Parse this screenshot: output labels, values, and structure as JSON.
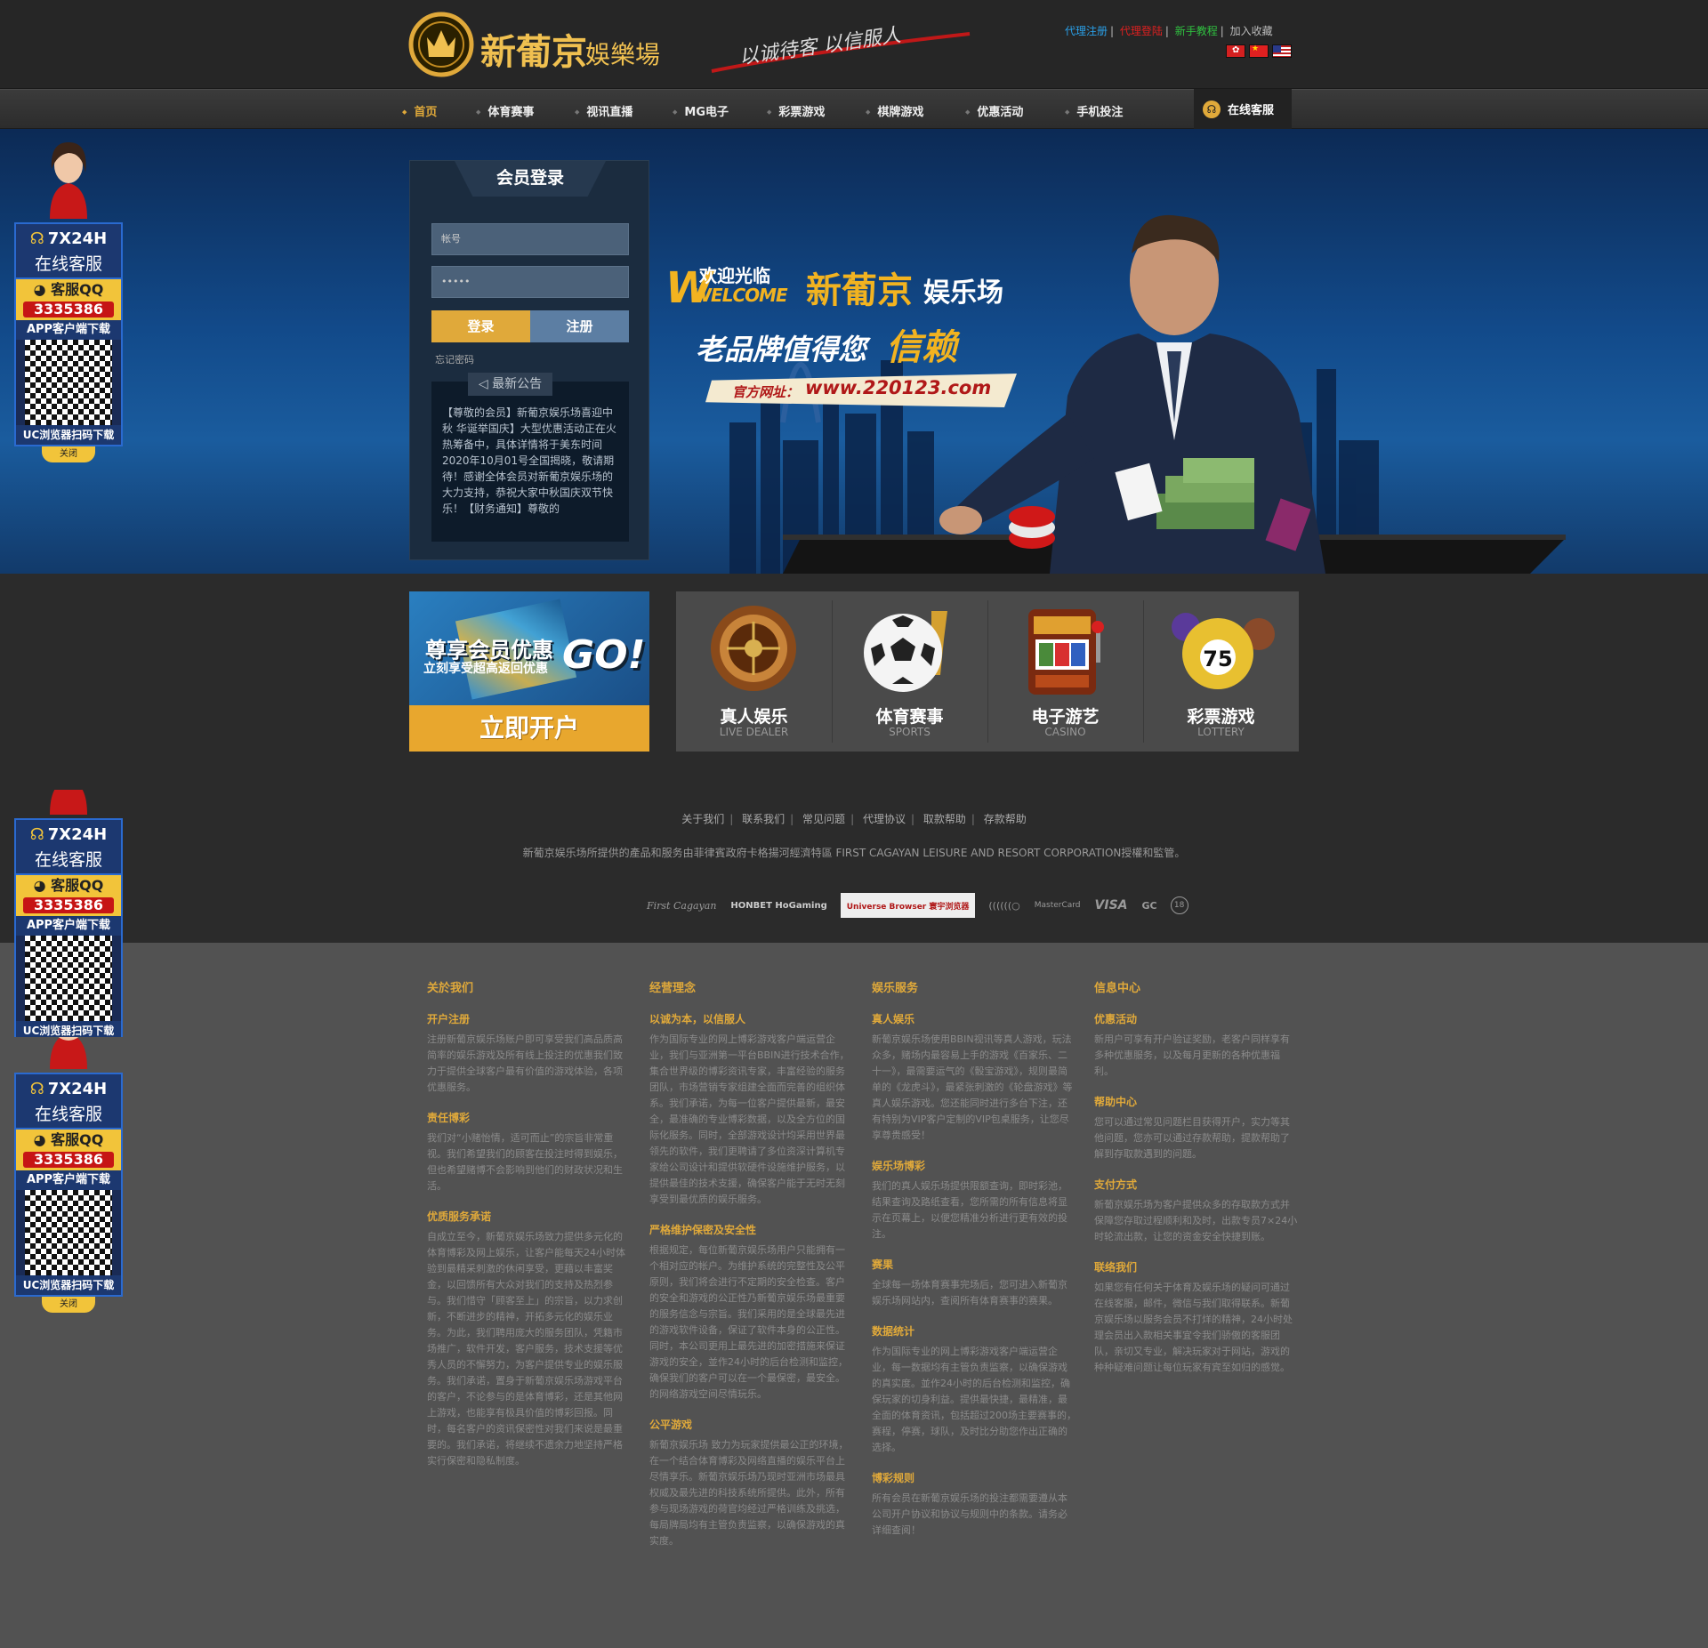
{
  "header": {
    "logo_text": "新葡京",
    "logo_sub": "娛樂場",
    "slogan": "以诚待客 以信服人",
    "links": [
      "代理注册",
      "代理登陆",
      "新手教程",
      "加入收藏"
    ],
    "link_colors": [
      "#2aa0e8",
      "#e02020",
      "#30c040",
      "#bbbbbb"
    ],
    "flags": [
      "hong-kong-flag",
      "china-flag",
      "usa-flag"
    ]
  },
  "nav": {
    "items": [
      "首页",
      "体育赛事",
      "视讯直播",
      "MG电子",
      "彩票游戏",
      "棋牌游戏",
      "优惠活动",
      "手机投注"
    ],
    "customer_service": "在线客服"
  },
  "login": {
    "title": "会员登录",
    "account_placeholder": "帐号",
    "password_value": "•••••",
    "login_button": "登录",
    "register_button": "注册",
    "forgot": "忘记密码",
    "notice_title": "最新公告",
    "notice_text": "【尊敬的会员】新葡京娱乐场喜迎中秋 华诞举国庆】大型优惠活动正在火热筹备中，具体详情将于美东时间2020年10月01号全国揭晓，敬请期待！感谢全体会员对新葡京娱乐场的大力支持，恭祝大家中秋国庆双节快乐！【财务通知】尊敬的"
  },
  "banner": {
    "welcome_cn": "欢迎光临",
    "welcome_en": "WELCOME",
    "brand": "新葡京",
    "brand_suffix": "娱乐场",
    "tagline_a": "老品牌值得您",
    "tagline_b": "信赖",
    "site_label": "官方网址：",
    "site_url": "www.220123.com"
  },
  "float_ad": {
    "hours": "7X24H",
    "service": "在线客服",
    "qq_label": "客服QQ",
    "qq_number": "3335386",
    "app": "APP客户端下载",
    "uc": "UC浏览器扫码下载",
    "close": "关闭"
  },
  "promo": {
    "title": "尊享会员优惠",
    "subtitle": "立刻享受超高返回优惠",
    "go": "GO!",
    "button": "立即开户"
  },
  "games": [
    {
      "title": "真人娱乐",
      "sub": "LIVE DEALER",
      "icon": "roulette-icon"
    },
    {
      "title": "体育赛事",
      "sub": "SPORTS",
      "icon": "soccer-ball-icon"
    },
    {
      "title": "电子游艺",
      "sub": "CASINO",
      "icon": "slot-machine-icon"
    },
    {
      "title": "彩票游戏",
      "sub": "LOTTERY",
      "icon": "lottery-ball-icon"
    }
  ],
  "lottery_ball_number": "75",
  "footer_links": [
    "关于我们",
    "联系我们",
    "常见问题",
    "代理协议",
    "取款帮助",
    "存款帮助"
  ],
  "license": "新葡京娱乐场所提供的產品和服务由菲律賓政府卡格揚河經濟特區 FIRST CAGAYAN LEISURE AND RESORT CORPORATION授權和監管。",
  "partners": [
    "First Cagayan",
    "HONBET HoGaming",
    "Universe Browser 寰宇浏览器",
    "((((((○",
    "MasterCard",
    "VISA",
    "GC",
    "18"
  ],
  "footer_columns": [
    {
      "title": "关於我们",
      "sections": [
        {
          "head": "开户注册",
          "text": "注册新葡京娱乐场账户即可享受我们高品质高简率的娱乐游戏及所有线上投注的优惠我们致力于提供全球客户最有价值的游戏体验，各项优惠服务。"
        },
        {
          "head": "责任博彩",
          "text": "我们对“小赌怡情，适可而止”的宗旨非常重视。我们希望我们的顾客在投注时得到娱乐，但也希望赌博不会影响到他们的财政状况和生活。"
        },
        {
          "head": "优质服务承诺",
          "text": "自成立至今，新葡京娱乐场致力提供多元化的体育博彩及网上娱乐，让客户能每天24小时体验到最精采刺激的休闲享受，更藉以丰富奖金，以回馈所有大众对我们的支持及热烈参与。我们惜守「顾客至上」的宗旨，以力求创新，不断进步的精神，开拓多元化的娱乐业务。为此，我们聘用庞大的服务团队，凭籍市场推广，软件开发，客户服务，技术支援等优秀人员的不懈努力，为客户提供专业的娱乐服务。我们承诺，置身于新葡京娱乐场游戏平台的客户，不论参与的是体育博彩，还是其他网上游戏，也能享有极具价值的博彩回报。同时，每名客户的资讯保密性对我们来说是最重要的。我们承诺，将继续不遗余力地坚持严格实行保密和隐私制度。"
        }
      ]
    },
    {
      "title": "经营理念",
      "sections": [
        {
          "head": "以诚为本，以信服人",
          "text": "作为国际专业的网上博彩游戏客户端运营企业，我们与亚洲第一平台BBIN进行技术合作，集合世界级的博彩资讯专家，丰富经验的服务团队，市场营销专家组建全面而完善的组织体系。我们承诺，为每一位客户提供最新，最安全，最准确的专业博彩数据，以及全方位的国际化服务。同时，全部游戏设计均采用世界最领先的软件，我们更聘请了多位资深计算机专家给公司设计和提供软硬件设施维护服务，以提供最佳的技术支援，确保客户能于无时无刻享受到最优质的娱乐服务。"
        },
        {
          "head": "严格维护保密及安全性",
          "text": "根据规定，每位新葡京娱乐场用户只能拥有一个相对应的帐户。为维护系统的完整性及公平原则，我们将会进行不定期的安全检查。客户的安全和游戏的公正性乃新葡京娱乐场最重要的服务信念与宗旨。我们采用的是全球最先进的游戏软件设备，保证了软件本身的公正性。同时，本公司更用上最先进的加密措施来保证游戏的安全，並作24小时的后台检测和监控，确保我们的客户可以在一个最保密，最安全。的网络游戏空间尽情玩乐。"
        },
        {
          "head": "公平游戏",
          "text": "新葡京娱乐场 致力为玩家提供最公正的环境，在一个结合体育博彩及网络直播的娱乐平台上尽情享乐。新葡京娱乐场乃现时亚洲市场最具权威及最先进的科技系统所提供。此外，所有参与现场游戏的荷官均经过严格训练及挑选，每局牌局均有主管负责监察，以确保游戏的真实度。"
        }
      ]
    },
    {
      "title": "娱乐服务",
      "sections": [
        {
          "head": "真人娱乐",
          "text": "新葡京娱乐场使用BBIN视讯等真人游戏，玩法众多，赌场内最容易上手的游戏《百家乐、二十一》，最需要运气的《骰宝游戏》，规则最简单的《龙虎斗》，最紧张刺激的《轮盘游戏》等真人娱乐游戏。您还能同时进行多台下注，还有特别为VIP客户定制的VIP包桌服务，让您尽享尊贵感受！"
        },
        {
          "head": "娱乐场博彩",
          "text": "我们的真人娱乐场提供限额查询，即时彩池，结果查询及路纸查看，您所需的所有信息将显示在页幕上，以便您精准分析进行更有效的投注。"
        },
        {
          "head": "赛果",
          "text": "全球每一场体育赛事完场后，您可进入新葡京娱乐场网站内，查阅所有体育赛事的赛果。"
        },
        {
          "head": "数据统计",
          "text": "作为国际专业的网上博彩游戏客户端运营企业，每一数据均有主管负责监察，以确保游戏的真实度。並作24小时的后台检测和监控，确保玩家的切身利益。提供最快捷，最精准，最全面的体育资讯，包括超过200场主要赛事的，赛程，停赛，球队，及时比分助您作出正确的选择。"
        },
        {
          "head": "博彩规则",
          "text": "所有会员在新葡京娱乐场的投注都需要遵从本公司开户协议和协议与规则中的条款。请务必详细查阅！"
        }
      ]
    },
    {
      "title": "信息中心",
      "sections": [
        {
          "head": "优惠活动",
          "text": "新用户可享有开户验证奖励，老客户同样享有多种优惠服务，以及每月更新的各种优惠福利。"
        },
        {
          "head": "帮助中心",
          "text": "您可以通过常见问题栏目获得开户，实力等其他问题，您亦可以通过存款帮助，提款帮助了解到存取款遇到的问题。"
        },
        {
          "head": "支付方式",
          "text": "新葡京娱乐场为客户提供众多的存取款方式并保障您存取过程顺利和及时，出款专员7×24小时轮流出款，让您的资金安全快捷到账。"
        },
        {
          "head": "联络我们",
          "text": "如果您有任何关于体育及娱乐场的疑问可通过在线客服，邮件，微信与我们取得联系。新葡京娱乐场以服务会员不打烊的精神，24小时处理会员出入款相关事宜令我们骄傲的客服团队，亲切又专业，解决玩家对于网站，游戏的种种疑难问题让每位玩家有宾至如归的感觉。"
        }
      ]
    }
  ]
}
